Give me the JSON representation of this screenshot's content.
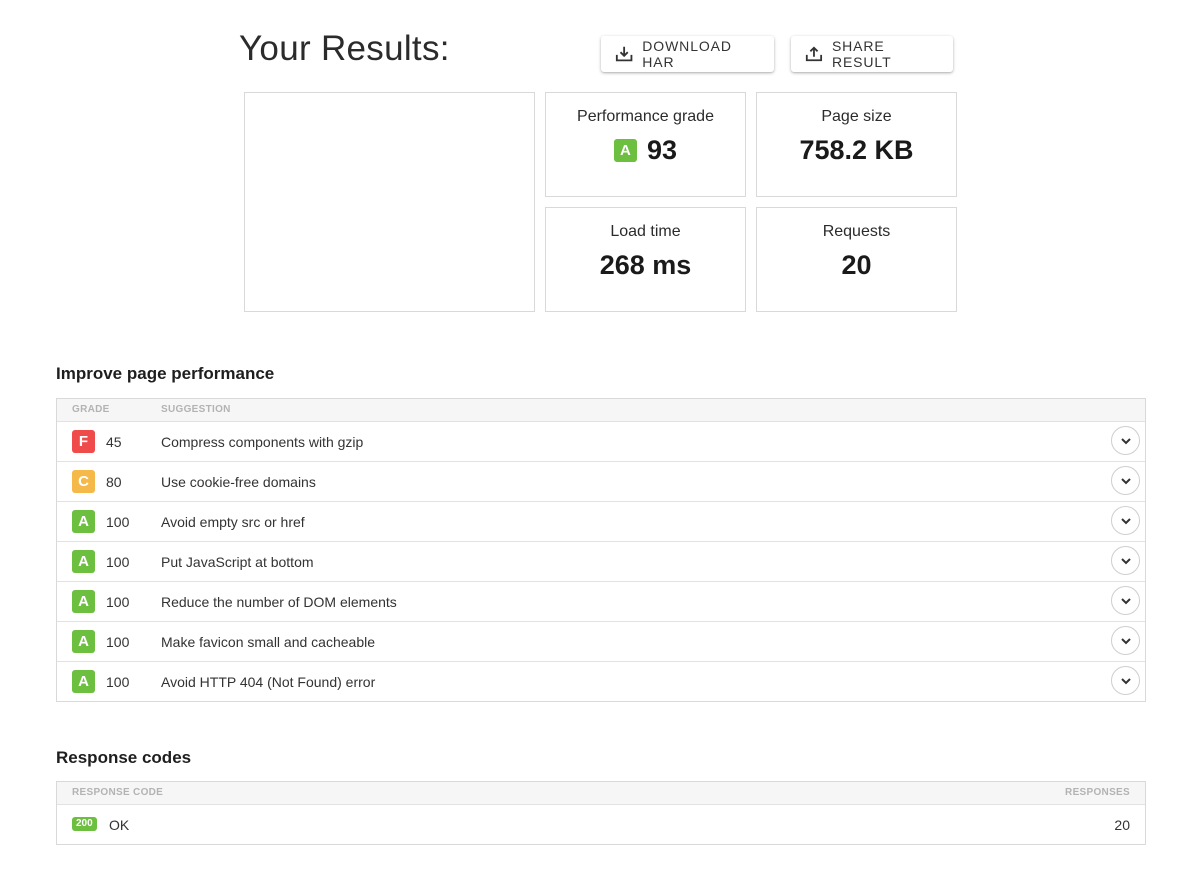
{
  "header": {
    "title": "Your Results:",
    "download_label": "DOWNLOAD HAR",
    "share_label": "SHARE RESULT"
  },
  "summary": {
    "grade_label": "Performance grade",
    "grade_letter": "A",
    "grade_value": "93",
    "size_label": "Page size",
    "size_value": "758.2 KB",
    "load_label": "Load time",
    "load_value": "268 ms",
    "requests_label": "Requests",
    "requests_value": "20"
  },
  "performance": {
    "title": "Improve page performance",
    "col_grade": "GRADE",
    "col_suggestion": "SUGGESTION",
    "rows": [
      {
        "grade": "F",
        "score": "45",
        "suggestion": "Compress components with gzip"
      },
      {
        "grade": "C",
        "score": "80",
        "suggestion": "Use cookie-free domains"
      },
      {
        "grade": "A",
        "score": "100",
        "suggestion": "Avoid empty src or href"
      },
      {
        "grade": "A",
        "score": "100",
        "suggestion": "Put JavaScript at bottom"
      },
      {
        "grade": "A",
        "score": "100",
        "suggestion": "Reduce the number of DOM elements"
      },
      {
        "grade": "A",
        "score": "100",
        "suggestion": "Make favicon small and cacheable"
      },
      {
        "grade": "A",
        "score": "100",
        "suggestion": "Avoid HTTP 404 (Not Found) error"
      }
    ]
  },
  "response_codes": {
    "title": "Response codes",
    "col_code": "RESPONSE CODE",
    "col_responses": "RESPONSES",
    "rows": [
      {
        "code": "200",
        "text": "OK",
        "responses": "20"
      }
    ]
  },
  "colors": {
    "grade_a": "#6cbf3f",
    "grade_c": "#f5b94a",
    "grade_f": "#f04b4b",
    "border": "#d9d9d9",
    "header_bg": "#f6f6f6"
  },
  "icons": {
    "download": "download-icon",
    "share": "share-icon",
    "expand": "chevron-down-icon"
  }
}
